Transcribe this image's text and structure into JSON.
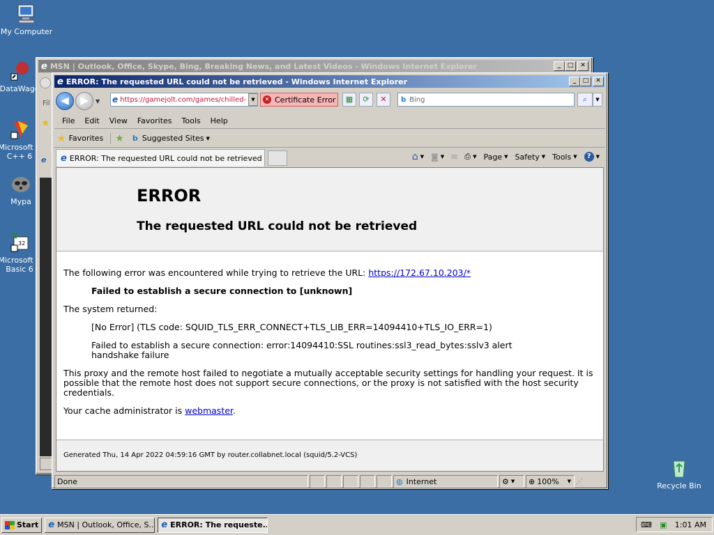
{
  "desktop": {
    "icons": [
      {
        "label": "My Computer"
      },
      {
        "label": "DataWage"
      },
      {
        "label": "Microsoft V C++ 6"
      },
      {
        "label": "Mypa"
      },
      {
        "label": "Microsoft V Basic 6"
      },
      {
        "label": "Recycle Bin"
      }
    ]
  },
  "back_window": {
    "title": "MSN | Outlook, Office, Skype, Bing, Breaking News, and Latest Videos - Windows Internet Explorer",
    "menu_fragment": "Fil"
  },
  "ie": {
    "title": "ERROR: The requested URL could not be retrieved - Windows Internet Explorer",
    "address": "https://gamejolt.com/games/chilled-",
    "certificate_error": "Certificate Error",
    "search_placeholder": "Bing",
    "menu": [
      "File",
      "Edit",
      "View",
      "Favorites",
      "Tools",
      "Help"
    ],
    "favorites_label": "Favorites",
    "suggested_sites": "Suggested Sites",
    "tab_title": "ERROR: The requested URL could not be retrieved",
    "commands": {
      "page": "Page",
      "safety": "Safety",
      "tools": "Tools"
    },
    "status": {
      "text": "Done",
      "zone": "Internet",
      "zoom": "100%"
    }
  },
  "page": {
    "heading": "ERROR",
    "subheading": "The requested URL could not be retrieved",
    "intro": "The following error was encountered while trying to retrieve the URL: ",
    "url": "https://172.67.10.203/*",
    "failed": "Failed to establish a secure connection to [unknown]",
    "system_returned": "The system returned:",
    "tls_code": "[No Error] (TLS code: SQUID_TLS_ERR_CONNECT+TLS_LIB_ERR=14094410+TLS_IO_ERR=1)",
    "ssl_error_1": "Failed to establish a secure connection: error:14094410:SSL routines:ssl3_read_bytes:sslv3 alert",
    "ssl_error_2": "handshake failure",
    "explanation": "This proxy and the remote host failed to negotiate a mutually acceptable security settings for handling your request. It is possible that the remote host does not support secure connections, or the proxy is not satisfied with the host security credentials.",
    "admin_prefix": "Your cache administrator is ",
    "admin_link": "webmaster",
    "admin_suffix": ".",
    "generated": "Generated Thu, 14 Apr 2022 04:59:16 GMT by router.collabnet.local (squid/5.2-VCS)"
  },
  "taskbar": {
    "start": "Start",
    "tasks": [
      "MSN | Outlook, Office, S...",
      "ERROR: The requeste..."
    ],
    "clock": "1:01 AM"
  }
}
